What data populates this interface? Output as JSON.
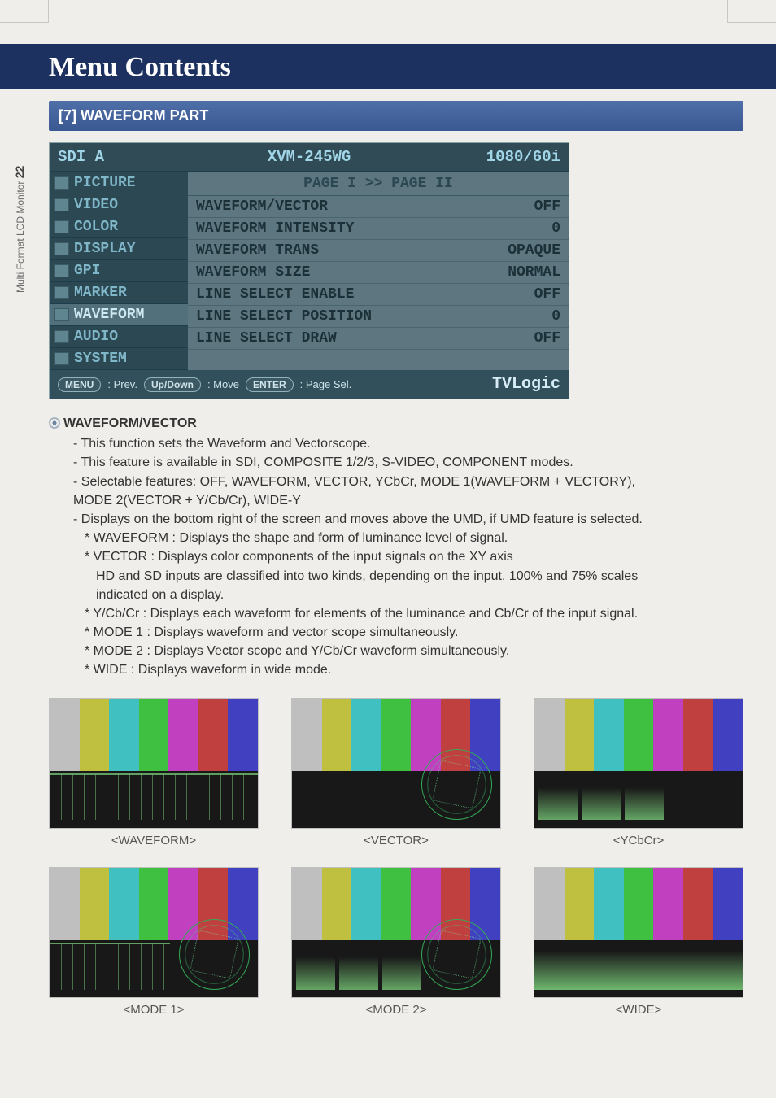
{
  "side_tab": {
    "prefix": "Multi Format LCD Monitor ",
    "page": "22"
  },
  "header": {
    "title": "Menu Contents"
  },
  "section": {
    "title": "[7] WAVEFORM PART"
  },
  "osd": {
    "top": {
      "left": "SDI A",
      "center": "XVM-245WG",
      "right": "1080/60i"
    },
    "nav": [
      "PICTURE",
      "VIDEO",
      "COLOR",
      "DISPLAY",
      "GPI",
      "MARKER",
      "WAVEFORM",
      "AUDIO",
      "SYSTEM"
    ],
    "nav_active_index": 6,
    "panel": {
      "page_indicator": "PAGE I >> PAGE II",
      "rows": [
        {
          "label": "WAVEFORM/VECTOR",
          "value": "OFF"
        },
        {
          "label": "WAVEFORM INTENSITY",
          "value": "0"
        },
        {
          "label": "WAVEFORM TRANS",
          "value": "OPAQUE"
        },
        {
          "label": "WAVEFORM SIZE",
          "value": "NORMAL"
        },
        {
          "label": "LINE SELECT ENABLE",
          "value": "OFF"
        },
        {
          "label": "LINE SELECT POSITION",
          "value": "0"
        },
        {
          "label": "LINE SELECT DRAW",
          "value": "OFF"
        }
      ]
    },
    "footer": {
      "hints": [
        {
          "key": "MENU",
          "text": ": Prev."
        },
        {
          "key": "Up/Down",
          "text": ": Move"
        },
        {
          "key": "ENTER",
          "text": ": Page Sel."
        }
      ],
      "brand": "TVLogic"
    }
  },
  "desc": {
    "heading": "WAVEFORM/VECTOR",
    "lines": [
      "- This function sets the Waveform and Vectorscope.",
      "- This feature is available in SDI, COMPOSITE 1/2/3, S-VIDEO, COMPONENT modes.",
      "- Selectable features: OFF, WAVEFORM, VECTOR, YCbCr, MODE 1(WAVEFORM + VECTORY),",
      "  MODE 2(VECTOR + Y/Cb/Cr), WIDE-Y",
      "- Displays on the bottom right of the screen and moves above the UMD, if UMD feature is selected."
    ],
    "subs": [
      "* WAVEFORM : Displays the shape and form of luminance level of signal.",
      "* VECTOR : Displays color components of the input signals on the XY axis",
      "   HD and SD inputs are classified into two kinds, depending on the input. 100% and 75% scales",
      "   indicated on a display.",
      "* Y/Cb/Cr : Displays each waveform for elements of the luminance and Cb/Cr of the input signal.",
      "* MODE 1 : Displays waveform and vector scope simultaneously.",
      "* MODE 2 : Displays Vector scope and Y/Cb/Cr waveform simultaneously.",
      "* WIDE : Displays waveform in wide mode."
    ]
  },
  "thumbs": [
    {
      "caption": "<WAVEFORM>",
      "variant": "waveform"
    },
    {
      "caption": "<VECTOR>",
      "variant": "vector"
    },
    {
      "caption": "<YCbCr>",
      "variant": "ycbcr"
    },
    {
      "caption": "<MODE 1>",
      "variant": "mode1"
    },
    {
      "caption": "<MODE 2>",
      "variant": "mode2"
    },
    {
      "caption": "<WIDE>",
      "variant": "wide"
    }
  ]
}
